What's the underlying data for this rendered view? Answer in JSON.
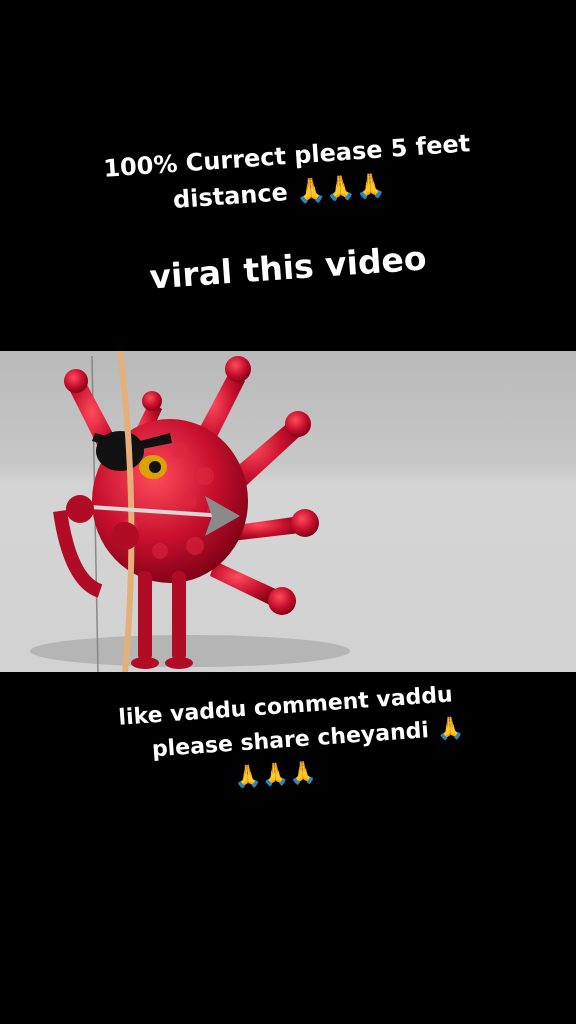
{
  "captions": {
    "top_line1": "100% Currect please 5 feet",
    "top_line2": "distance 🙏🙏🙏",
    "middle": "viral this video",
    "bottom_line1": "like vaddu comment vaddu",
    "bottom_line2": "please share cheyandi 🙏",
    "bottom_line3": "🙏🙏🙏"
  },
  "video": {
    "subject": "red virus character with bow and arrow"
  },
  "colors": {
    "background": "#000000",
    "text": "#ffffff",
    "virus": "#c8102e"
  }
}
